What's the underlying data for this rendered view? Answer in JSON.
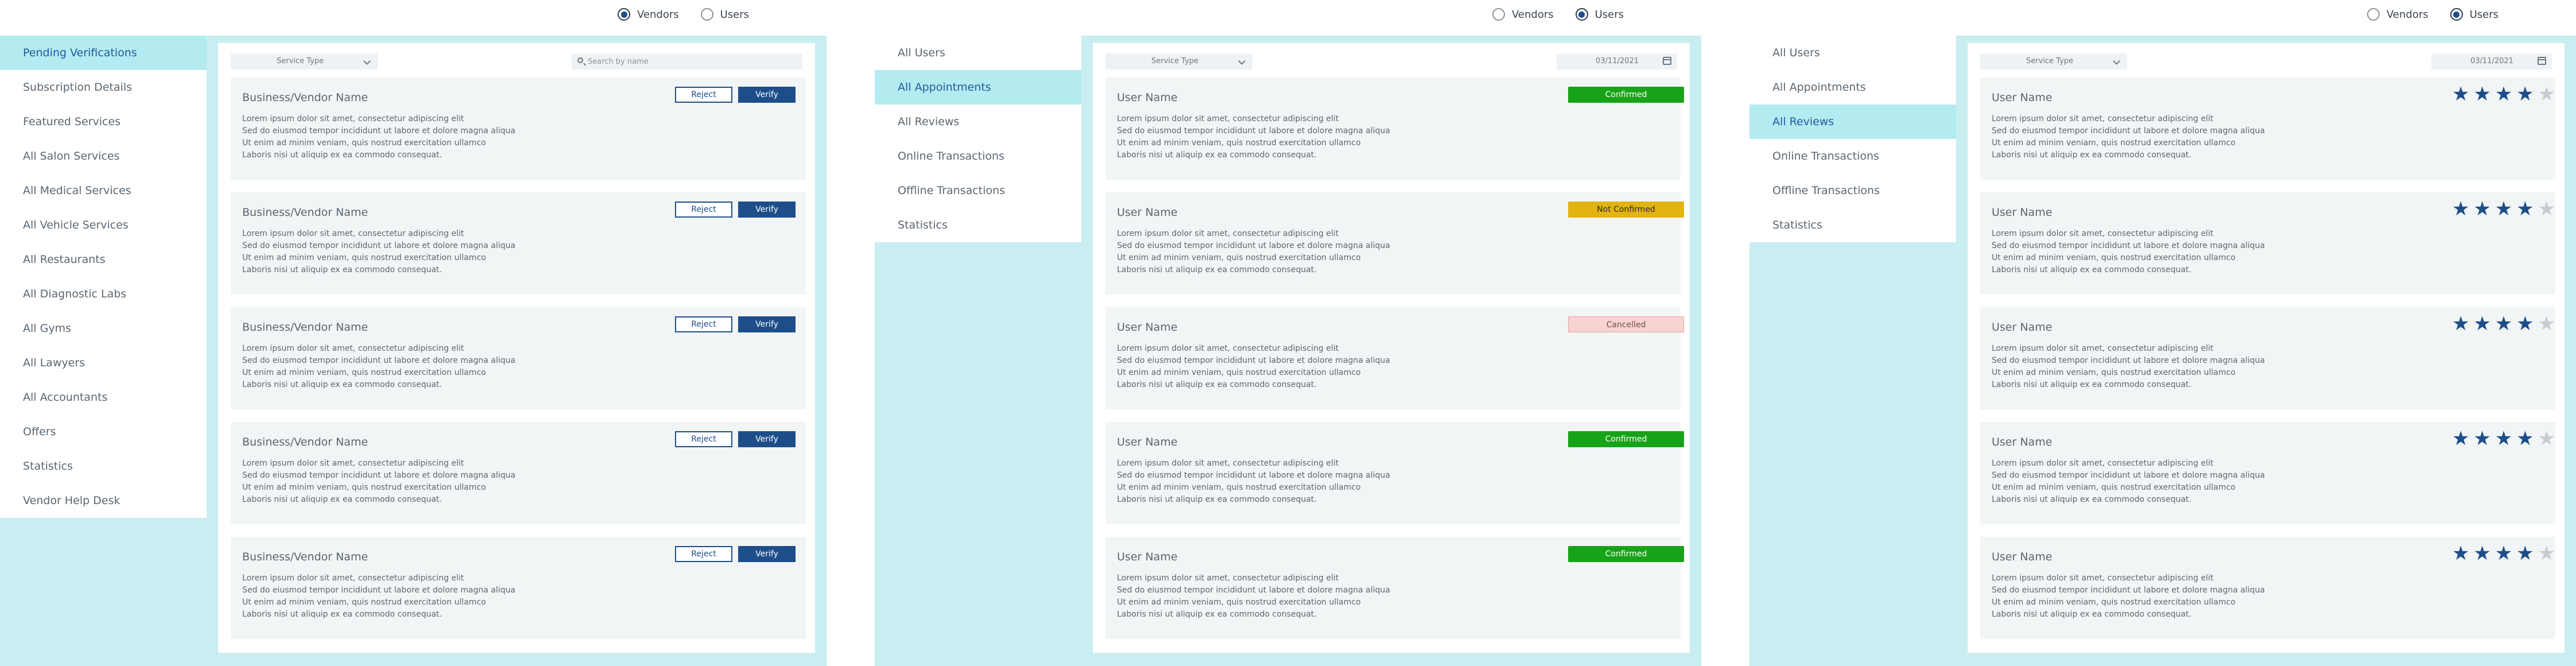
{
  "colors": {
    "accent": "#1d4e89",
    "light_cyan": "#c8eef1",
    "active_nav": "#b4ebf1",
    "confirmed": "#17a317",
    "not_confirmed": "#e3b312",
    "cancelled": "#f7d3d3",
    "star_on": "#1d4e89",
    "star_off": "#c8ccd0"
  },
  "screens": [
    {
      "radio": [
        {
          "label": "Vendors",
          "selected": true
        },
        {
          "label": "Users",
          "selected": false
        }
      ],
      "nav": [
        {
          "label": "Pending Verifications",
          "active": true
        },
        {
          "label": "Subscription Details",
          "active": false
        },
        {
          "label": "Featured Services",
          "active": false
        },
        {
          "label": "All Salon Services",
          "active": false
        },
        {
          "label": "All Medical Services",
          "active": false
        },
        {
          "label": "All Vehicle Services",
          "active": false
        },
        {
          "label": "All Restaurants",
          "active": false
        },
        {
          "label": "All Diagnostic Labs",
          "active": false
        },
        {
          "label": "All Gyms",
          "active": false
        },
        {
          "label": "All Lawyers",
          "active": false
        },
        {
          "label": "All Accountants",
          "active": false
        },
        {
          "label": "Offers",
          "active": false
        },
        {
          "label": "Statistics",
          "active": false
        },
        {
          "label": "Vendor Help Desk",
          "active": false
        }
      ],
      "filter": {
        "select": "Service Type",
        "search_placeholder": "Search by name"
      },
      "cards": [
        {
          "title": "Business/Vendor Name",
          "reject": "Reject",
          "verify": "Verify"
        },
        {
          "title": "Business/Vendor Name",
          "reject": "Reject",
          "verify": "Verify"
        },
        {
          "title": "Business/Vendor Name",
          "reject": "Reject",
          "verify": "Verify"
        },
        {
          "title": "Business/Vendor Name",
          "reject": "Reject",
          "verify": "Verify"
        },
        {
          "title": "Business/Vendor Name",
          "reject": "Reject",
          "verify": "Verify"
        }
      ]
    },
    {
      "radio": [
        {
          "label": "Vendors",
          "selected": false
        },
        {
          "label": "Users",
          "selected": true
        }
      ],
      "nav": [
        {
          "label": "All Users",
          "active": false
        },
        {
          "label": "All Appointments",
          "active": true
        },
        {
          "label": "All Reviews",
          "active": false
        },
        {
          "label": "Online Transactions",
          "active": false
        },
        {
          "label": "Offline Transactions",
          "active": false
        },
        {
          "label": "Statistics",
          "active": false
        }
      ],
      "filter": {
        "select": "Service Type",
        "date": "03/11/2021"
      },
      "cards": [
        {
          "title": "User Name",
          "status": "Confirmed"
        },
        {
          "title": "User Name",
          "status": "Not Confirmed"
        },
        {
          "title": "User Name",
          "status": "Cancelled"
        },
        {
          "title": "User Name",
          "status": "Confirmed"
        },
        {
          "title": "User Name",
          "status": "Confirmed"
        }
      ]
    },
    {
      "radio": [
        {
          "label": "Vendors",
          "selected": false
        },
        {
          "label": "Users",
          "selected": true
        }
      ],
      "nav": [
        {
          "label": "All Users",
          "active": false
        },
        {
          "label": "All Appointments",
          "active": false
        },
        {
          "label": "All Reviews",
          "active": true
        },
        {
          "label": "Online Transactions",
          "active": false
        },
        {
          "label": "Offline Transactions",
          "active": false
        },
        {
          "label": "Statistics",
          "active": false
        }
      ],
      "filter": {
        "select": "Service Type",
        "date": "03/11/2021"
      },
      "cards": [
        {
          "title": "User Name",
          "rating": 4,
          "max_rating": 5
        },
        {
          "title": "User Name",
          "rating": 4,
          "max_rating": 5
        },
        {
          "title": "User Name",
          "rating": 4,
          "max_rating": 5
        },
        {
          "title": "User Name",
          "rating": 4,
          "max_rating": 5
        },
        {
          "title": "User Name",
          "rating": 4,
          "max_rating": 5
        }
      ]
    }
  ],
  "lorem": [
    "Lorem ipsum dolor sit amet, consectetur adipiscing elit",
    "Sed do eiusmod tempor incididunt ut labore et dolore magna aliqua",
    "Ut enim ad minim veniam, quis nostrud exercitation ullamco",
    "Laboris nisi ut aliquip ex ea commodo consequat."
  ]
}
